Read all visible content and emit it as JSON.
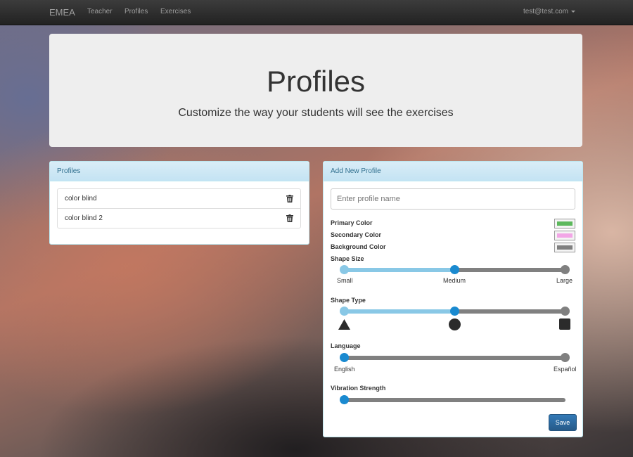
{
  "navbar": {
    "brand": "EMEA",
    "links": [
      "Teacher",
      "Profiles",
      "Exercises"
    ],
    "user": "test@test.com"
  },
  "jumbotron": {
    "title": "Profiles",
    "subtitle": "Customize the way your students will see the exercises"
  },
  "profiles_panel": {
    "heading": "Profiles",
    "items": [
      "color blind",
      "color blind 2"
    ]
  },
  "add_panel": {
    "heading": "Add New Profile",
    "name_placeholder": "Enter profile name",
    "primary_color_label": "Primary Color",
    "primary_color": "#5cb85c",
    "secondary_color_label": "Secondary Color",
    "secondary_color": "#f2a6e6",
    "background_color_label": "Background Color",
    "background_color": "#808080",
    "shape_size": {
      "label": "Shape Size",
      "options": [
        "Small",
        "Medium",
        "Large"
      ],
      "selected": "Medium"
    },
    "shape_type": {
      "label": "Shape Type",
      "options": [
        "triangle-icon",
        "circle-icon",
        "square-icon"
      ],
      "selected": "circle-icon"
    },
    "language": {
      "label": "Language",
      "options": [
        "English",
        "Español"
      ],
      "selected": "English"
    },
    "vibration": {
      "label": "Vibration Strength",
      "value": 0
    },
    "save_label": "Save"
  }
}
